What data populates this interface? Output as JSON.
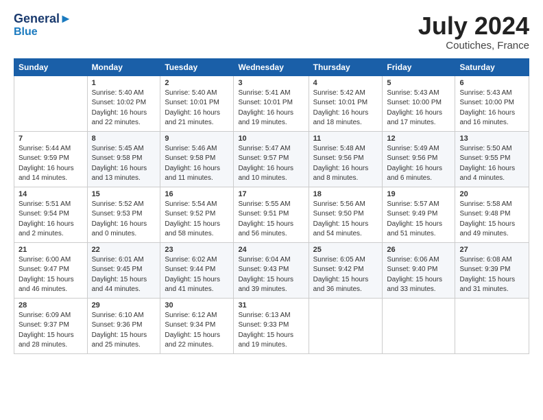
{
  "header": {
    "logo_line1": "General",
    "logo_line2": "Blue",
    "month": "July 2024",
    "location": "Coutiches, France"
  },
  "columns": [
    "Sunday",
    "Monday",
    "Tuesday",
    "Wednesday",
    "Thursday",
    "Friday",
    "Saturday"
  ],
  "weeks": [
    [
      {
        "num": "",
        "info": ""
      },
      {
        "num": "1",
        "info": "Sunrise: 5:40 AM\nSunset: 10:02 PM\nDaylight: 16 hours\nand 22 minutes."
      },
      {
        "num": "2",
        "info": "Sunrise: 5:40 AM\nSunset: 10:01 PM\nDaylight: 16 hours\nand 21 minutes."
      },
      {
        "num": "3",
        "info": "Sunrise: 5:41 AM\nSunset: 10:01 PM\nDaylight: 16 hours\nand 19 minutes."
      },
      {
        "num": "4",
        "info": "Sunrise: 5:42 AM\nSunset: 10:01 PM\nDaylight: 16 hours\nand 18 minutes."
      },
      {
        "num": "5",
        "info": "Sunrise: 5:43 AM\nSunset: 10:00 PM\nDaylight: 16 hours\nand 17 minutes."
      },
      {
        "num": "6",
        "info": "Sunrise: 5:43 AM\nSunset: 10:00 PM\nDaylight: 16 hours\nand 16 minutes."
      }
    ],
    [
      {
        "num": "7",
        "info": "Sunrise: 5:44 AM\nSunset: 9:59 PM\nDaylight: 16 hours\nand 14 minutes."
      },
      {
        "num": "8",
        "info": "Sunrise: 5:45 AM\nSunset: 9:58 PM\nDaylight: 16 hours\nand 13 minutes."
      },
      {
        "num": "9",
        "info": "Sunrise: 5:46 AM\nSunset: 9:58 PM\nDaylight: 16 hours\nand 11 minutes."
      },
      {
        "num": "10",
        "info": "Sunrise: 5:47 AM\nSunset: 9:57 PM\nDaylight: 16 hours\nand 10 minutes."
      },
      {
        "num": "11",
        "info": "Sunrise: 5:48 AM\nSunset: 9:56 PM\nDaylight: 16 hours\nand 8 minutes."
      },
      {
        "num": "12",
        "info": "Sunrise: 5:49 AM\nSunset: 9:56 PM\nDaylight: 16 hours\nand 6 minutes."
      },
      {
        "num": "13",
        "info": "Sunrise: 5:50 AM\nSunset: 9:55 PM\nDaylight: 16 hours\nand 4 minutes."
      }
    ],
    [
      {
        "num": "14",
        "info": "Sunrise: 5:51 AM\nSunset: 9:54 PM\nDaylight: 16 hours\nand 2 minutes."
      },
      {
        "num": "15",
        "info": "Sunrise: 5:52 AM\nSunset: 9:53 PM\nDaylight: 16 hours\nand 0 minutes."
      },
      {
        "num": "16",
        "info": "Sunrise: 5:54 AM\nSunset: 9:52 PM\nDaylight: 15 hours\nand 58 minutes."
      },
      {
        "num": "17",
        "info": "Sunrise: 5:55 AM\nSunset: 9:51 PM\nDaylight: 15 hours\nand 56 minutes."
      },
      {
        "num": "18",
        "info": "Sunrise: 5:56 AM\nSunset: 9:50 PM\nDaylight: 15 hours\nand 54 minutes."
      },
      {
        "num": "19",
        "info": "Sunrise: 5:57 AM\nSunset: 9:49 PM\nDaylight: 15 hours\nand 51 minutes."
      },
      {
        "num": "20",
        "info": "Sunrise: 5:58 AM\nSunset: 9:48 PM\nDaylight: 15 hours\nand 49 minutes."
      }
    ],
    [
      {
        "num": "21",
        "info": "Sunrise: 6:00 AM\nSunset: 9:47 PM\nDaylight: 15 hours\nand 46 minutes."
      },
      {
        "num": "22",
        "info": "Sunrise: 6:01 AM\nSunset: 9:45 PM\nDaylight: 15 hours\nand 44 minutes."
      },
      {
        "num": "23",
        "info": "Sunrise: 6:02 AM\nSunset: 9:44 PM\nDaylight: 15 hours\nand 41 minutes."
      },
      {
        "num": "24",
        "info": "Sunrise: 6:04 AM\nSunset: 9:43 PM\nDaylight: 15 hours\nand 39 minutes."
      },
      {
        "num": "25",
        "info": "Sunrise: 6:05 AM\nSunset: 9:42 PM\nDaylight: 15 hours\nand 36 minutes."
      },
      {
        "num": "26",
        "info": "Sunrise: 6:06 AM\nSunset: 9:40 PM\nDaylight: 15 hours\nand 33 minutes."
      },
      {
        "num": "27",
        "info": "Sunrise: 6:08 AM\nSunset: 9:39 PM\nDaylight: 15 hours\nand 31 minutes."
      }
    ],
    [
      {
        "num": "28",
        "info": "Sunrise: 6:09 AM\nSunset: 9:37 PM\nDaylight: 15 hours\nand 28 minutes."
      },
      {
        "num": "29",
        "info": "Sunrise: 6:10 AM\nSunset: 9:36 PM\nDaylight: 15 hours\nand 25 minutes."
      },
      {
        "num": "30",
        "info": "Sunrise: 6:12 AM\nSunset: 9:34 PM\nDaylight: 15 hours\nand 22 minutes."
      },
      {
        "num": "31",
        "info": "Sunrise: 6:13 AM\nSunset: 9:33 PM\nDaylight: 15 hours\nand 19 minutes."
      },
      {
        "num": "",
        "info": ""
      },
      {
        "num": "",
        "info": ""
      },
      {
        "num": "",
        "info": ""
      }
    ]
  ]
}
